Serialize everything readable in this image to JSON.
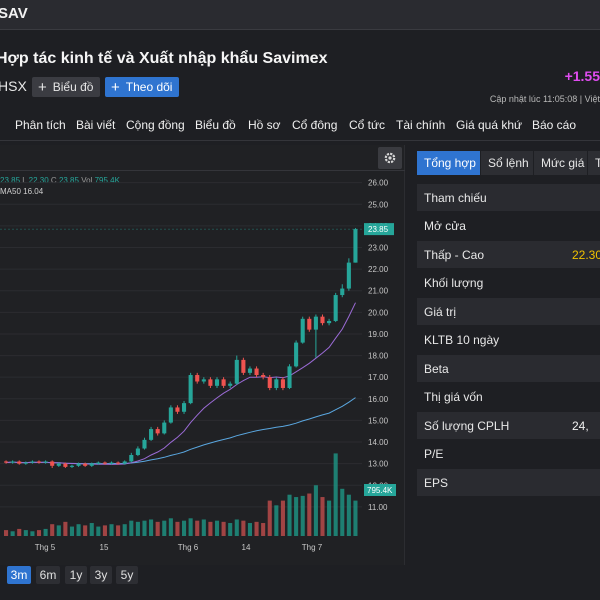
{
  "header": {
    "ticker": "SAV",
    "company_name": "Hợp tác kinh tế và Xuất nhập khẩu Savimex",
    "exchange": "HSX",
    "chart_button": "Biểu đồ",
    "follow_button": "Theo dõi",
    "price_change": "+1.55",
    "updated_text": "Cập nhật lúc  11:05:08 | Việt",
    "colors": {
      "change": "#e04cf0",
      "follow": "#2f74d0"
    }
  },
  "nav": {
    "items": [
      "Phân tích",
      "Bài viết",
      "Cộng đồng",
      "Biểu đồ",
      "Hồ sơ",
      "Cổ đông",
      "Cổ tức",
      "Tài chính",
      "Giá quá khứ",
      "Báo cáo"
    ]
  },
  "legend": {
    "ohlc_prefix": "23.85",
    "low_label": "L",
    "low_value": "22.30",
    "close_label": "C",
    "close_value": "23.85",
    "vol_label": "Vol",
    "vol_value": "795.4K",
    "ma_label": "MA50",
    "ma_value": "16.04"
  },
  "chart_data": {
    "type": "candlestick",
    "y_axis_ticks": [
      "26.00",
      "25.00",
      "24.00",
      "23.00",
      "22.00",
      "21.00",
      "20.00",
      "19.00",
      "18.00",
      "17.00",
      "16.00",
      "15.00",
      "14.00",
      "13.00",
      "12.00",
      "11.00"
    ],
    "ylim": [
      10.3,
      26.4
    ],
    "x_axis_labels": [
      "Thg 5",
      "15",
      "Thg 6",
      "14",
      "Thg 7"
    ],
    "last_price_label": "23.85",
    "last_volume_label": "795.4K",
    "candles": [
      [
        13.1,
        13.05,
        13.15,
        13.0
      ],
      [
        13.05,
        13.1,
        13.15,
        13.0
      ],
      [
        13.1,
        13.0,
        13.15,
        12.95
      ],
      [
        13.0,
        13.05,
        13.1,
        12.95
      ],
      [
        13.05,
        13.1,
        13.15,
        13.0
      ],
      [
        13.1,
        13.05,
        13.15,
        13.0
      ],
      [
        13.05,
        13.1,
        13.15,
        13.0
      ],
      [
        13.1,
        12.9,
        13.15,
        12.8
      ],
      [
        12.9,
        13.0,
        13.05,
        12.85
      ],
      [
        13.0,
        12.85,
        13.05,
        12.8
      ],
      [
        12.85,
        12.9,
        12.95,
        12.8
      ],
      [
        12.9,
        13.0,
        13.05,
        12.85
      ],
      [
        13.0,
        12.9,
        13.05,
        12.85
      ],
      [
        12.9,
        13.0,
        13.05,
        12.85
      ],
      [
        13.0,
        13.05,
        13.1,
        12.95
      ],
      [
        13.05,
        13.0,
        13.1,
        12.95
      ],
      [
        13.0,
        13.05,
        13.1,
        12.95
      ],
      [
        13.05,
        13.0,
        13.1,
        12.95
      ],
      [
        13.0,
        13.1,
        13.15,
        12.95
      ],
      [
        13.1,
        13.4,
        13.5,
        13.05
      ],
      [
        13.4,
        13.7,
        13.8,
        13.35
      ],
      [
        13.7,
        14.1,
        14.2,
        13.65
      ],
      [
        14.1,
        14.6,
        14.7,
        14.05
      ],
      [
        14.6,
        14.4,
        14.7,
        14.3
      ],
      [
        14.4,
        14.9,
        15.0,
        14.35
      ],
      [
        14.9,
        15.6,
        15.7,
        14.85
      ],
      [
        15.6,
        15.4,
        15.7,
        15.3
      ],
      [
        15.4,
        15.8,
        15.9,
        15.3
      ],
      [
        15.8,
        17.1,
        17.2,
        15.75
      ],
      [
        17.1,
        16.8,
        17.2,
        16.7
      ],
      [
        16.8,
        16.9,
        17.0,
        16.7
      ],
      [
        16.9,
        16.6,
        17.0,
        16.5
      ],
      [
        16.6,
        16.9,
        17.0,
        16.5
      ],
      [
        16.9,
        16.6,
        17.0,
        16.5
      ],
      [
        16.6,
        16.7,
        16.8,
        16.5
      ],
      [
        16.7,
        17.8,
        18.0,
        16.65
      ],
      [
        17.8,
        17.2,
        17.9,
        17.1
      ],
      [
        17.2,
        17.4,
        17.5,
        17.1
      ],
      [
        17.4,
        17.1,
        17.5,
        17.0
      ],
      [
        17.1,
        17.0,
        17.2,
        16.9
      ],
      [
        17.0,
        16.5,
        17.1,
        16.4
      ],
      [
        16.5,
        16.9,
        17.0,
        16.4
      ],
      [
        16.9,
        16.5,
        17.0,
        16.4
      ],
      [
        16.5,
        17.5,
        17.6,
        16.45
      ],
      [
        17.5,
        18.6,
        18.7,
        17.45
      ],
      [
        18.6,
        19.7,
        19.8,
        18.55
      ],
      [
        19.7,
        19.2,
        19.8,
        19.1
      ],
      [
        19.2,
        19.8,
        19.9,
        17.9
      ],
      [
        19.8,
        19.5,
        19.9,
        19.4
      ],
      [
        19.5,
        19.6,
        19.7,
        19.4
      ],
      [
        19.6,
        20.8,
        20.9,
        19.55
      ],
      [
        20.8,
        21.1,
        21.3,
        20.7
      ],
      [
        21.1,
        22.3,
        22.5,
        21.0
      ],
      [
        22.3,
        23.85,
        23.9,
        22.3
      ]
    ],
    "volumes": [
      0.05,
      0.04,
      0.06,
      0.05,
      0.04,
      0.05,
      0.06,
      0.1,
      0.09,
      0.12,
      0.08,
      0.1,
      0.09,
      0.11,
      0.08,
      0.09,
      0.1,
      0.09,
      0.1,
      0.13,
      0.12,
      0.13,
      0.14,
      0.12,
      0.13,
      0.15,
      0.12,
      0.13,
      0.15,
      0.13,
      0.14,
      0.12,
      0.13,
      0.12,
      0.11,
      0.14,
      0.13,
      0.11,
      0.12,
      0.11,
      0.3,
      0.26,
      0.3,
      0.35,
      0.33,
      0.34,
      0.36,
      0.43,
      0.33,
      0.3,
      0.7,
      0.4,
      0.35,
      0.3
    ],
    "volume_max": 1.0
  },
  "range_buttons": [
    "3m",
    "6m",
    "1y",
    "3y",
    "5y"
  ],
  "right_panel": {
    "tabs": [
      "Tổng hợp",
      "Sổ lệnh",
      "Mức giá",
      "T"
    ],
    "rows": [
      {
        "label": "Tham chiếu",
        "value": ""
      },
      {
        "label": "Mở cửa",
        "value": ""
      },
      {
        "label": "Thấp - Cao",
        "value": "22.30"
      },
      {
        "label": "Khối lượng",
        "value": ""
      },
      {
        "label": "Giá trị",
        "value": ""
      },
      {
        "label": "KLTB 10 ngày",
        "value": ""
      },
      {
        "label": "Beta",
        "value": ""
      },
      {
        "label": "Thị giá vốn",
        "value": ""
      },
      {
        "label": "Số lượng CPLH",
        "value": "24,"
      },
      {
        "label": "P/E",
        "value": ""
      },
      {
        "label": "EPS",
        "value": ""
      }
    ]
  }
}
